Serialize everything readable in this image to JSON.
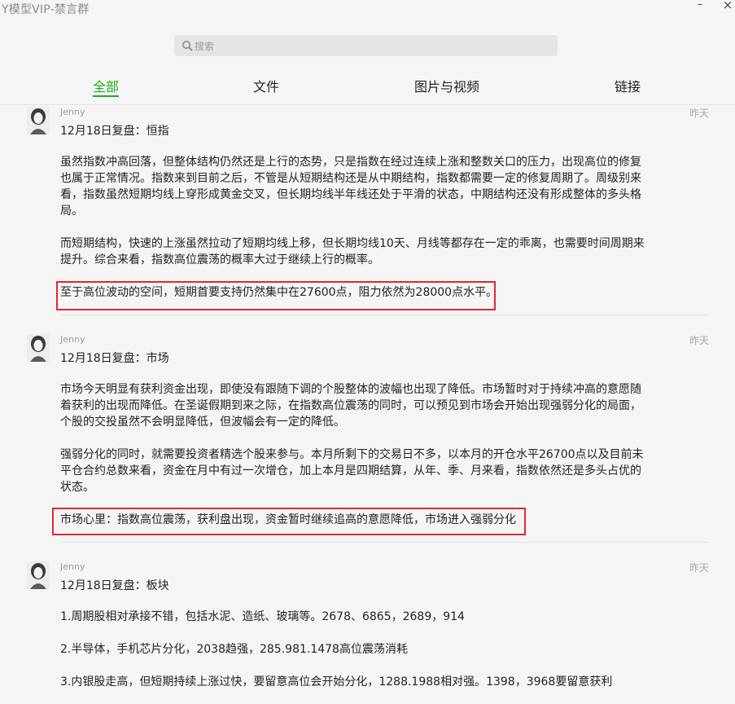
{
  "window": {
    "title": "Y模型VIP-禁言群",
    "minimize_glyph": "–",
    "close_glyph": "×"
  },
  "search": {
    "placeholder": "搜索",
    "icon": "search-icon"
  },
  "tabs": [
    {
      "label": "全部",
      "active": true
    },
    {
      "label": "文件",
      "active": false
    },
    {
      "label": "图片与视频",
      "active": false
    },
    {
      "label": "链接",
      "active": false
    }
  ],
  "colors": {
    "accent": "#1aad19",
    "highlight_box": "#e0292d"
  },
  "messages": [
    {
      "sender": "Jenny",
      "time": "昨天",
      "title": "12月18日复盘：恒指",
      "paragraphs": [
        "虽然指数冲高回落，但整体结构仍然还是上行的态势，只是指数在经过连续上涨和整数关口的压力，出现高位的修复也属于正常情况。指数来到目前之后，不管是从短期结构还是从中期结构，指数都需要一定的修复周期了。周级别来看，指数虽然短期均线上穿形成黄金交叉，但长期均线半年线还处于平滑的状态，中期结构还没有形成整体的多头格局。",
        "而短期结构，快速的上涨虽然拉动了短期均线上移，但长期均线10天、月线等都存在一定的乖离，也需要时间周期来提升。综合来看，指数高位震荡的概率大过于继续上行的概率。",
        "至于高位波动的空间，短期首要支持仍然集中在27600点，阻力依然为28000点水平。"
      ]
    },
    {
      "sender": "Jenny",
      "time": "昨天",
      "title": "12月18日复盘：市场",
      "paragraphs": [
        "市场今天明显有获利资金出现，即使没有跟随下调的个股整体的波幅也出现了降低。市场暂时对于持续冲高的意愿随着获利的出现而降低。在圣诞假期到来之际，在指数高位震荡的同时，可以预见到市场会开始出现强弱分化的局面，个股的交投虽然不会明显降低，但波幅会有一定的降低。",
        "强弱分化的同时，就需要投资者精选个股来参与。本月所剩下的交易日不多，以本月的开仓水平26700点以及目前未平仓合约总数来看，资金在月中有过一次增仓，加上本月是四期结算，从年、季、月来看，指数依然还是多头占优的状态。",
        "市场心里：指数高位震荡，获利盘出现，资金暂时继续追高的意愿降低，市场进入强弱分化"
      ]
    },
    {
      "sender": "Jenny",
      "time": "昨天",
      "title": "12月18日复盘：板块",
      "paragraphs": [
        "1.周期股相对承接不错，包括水泥、造纸、玻璃等。2678、6865，2689，914",
        "2.半导体，手机芯片分化，2038趋强，285.981.1478高位震荡消耗",
        "3.内银股走高，但短期持续上涨过快，要留意高位会开始分化，1288.1988相对强。1398，3968要留意获利"
      ]
    }
  ]
}
